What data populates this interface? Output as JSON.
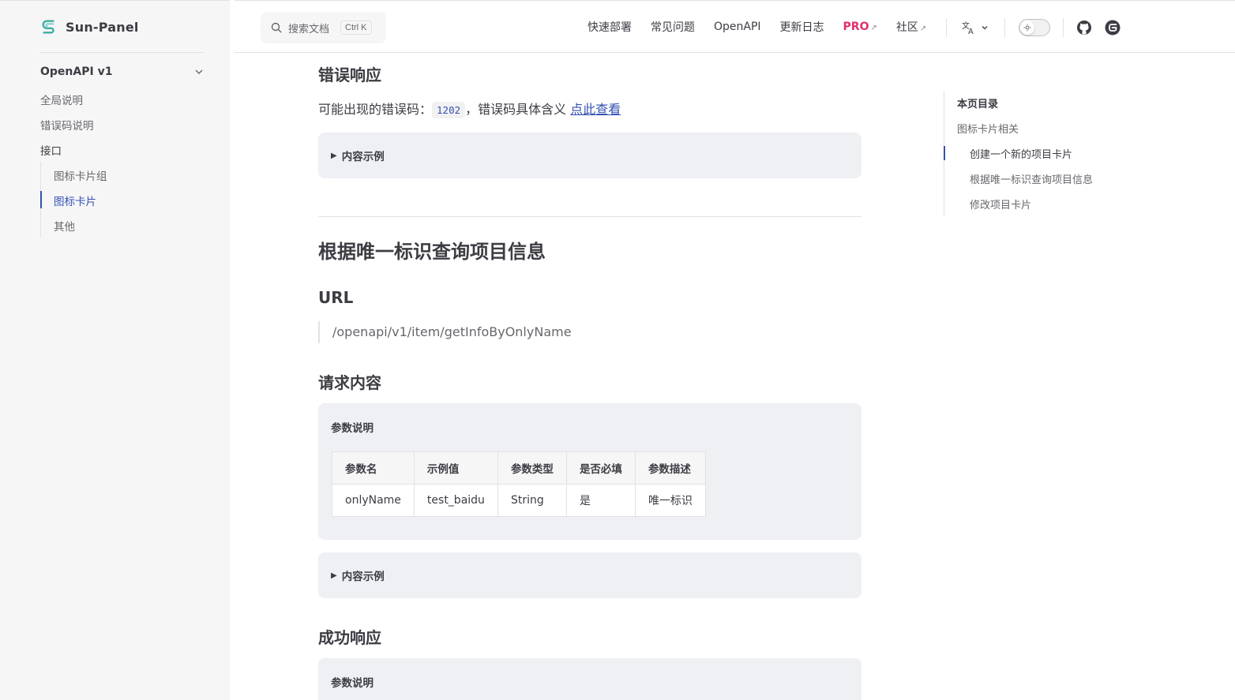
{
  "brand": {
    "name": "Sun-Panel"
  },
  "sidebar": {
    "section_title": "OpenAPI v1",
    "items": [
      {
        "label": "全局说明"
      },
      {
        "label": "错误码说明"
      },
      {
        "label": "接口"
      }
    ],
    "subitems": [
      {
        "label": "图标卡片组"
      },
      {
        "label": "图标卡片",
        "active": true
      },
      {
        "label": "其他"
      }
    ]
  },
  "search": {
    "placeholder": "搜索文档",
    "shortcut": "Ctrl K"
  },
  "topnav": {
    "items": [
      {
        "label": "快速部署"
      },
      {
        "label": "常见问题"
      },
      {
        "label": "OpenAPI"
      },
      {
        "label": "更新日志"
      },
      {
        "label": "PRO",
        "external": "↗"
      },
      {
        "label": "社区",
        "external": "↗"
      }
    ]
  },
  "content": {
    "error_heading": "错误响应",
    "error_text_before": "可能出现的错误码：",
    "error_code": "1202",
    "error_text_after": "，错误码具体含义 ",
    "error_link": "点此查看",
    "details_label_1": "内容示例",
    "section_title": "根据唯一标识查询项目信息",
    "url_heading": "URL",
    "url_value": "/openapi/v1/item/getInfoByOnlyName",
    "request_heading": "请求内容",
    "params_card_title": "参数说明",
    "params_table": {
      "headers": [
        "参数名",
        "示例值",
        "参数类型",
        "是否必填",
        "参数描述"
      ],
      "rows": [
        [
          "onlyName",
          "test_baidu",
          "String",
          "是",
          "唯一标识"
        ]
      ]
    },
    "details_label_2": "内容示例",
    "success_heading": "成功响应",
    "success_card_title": "参数说明"
  },
  "toc": {
    "title": "本页目录",
    "items": [
      {
        "label": "图标卡片相关"
      },
      {
        "label": "创建一个新的项目卡片",
        "active": true
      },
      {
        "label": "根据唯一标识查询项目信息"
      },
      {
        "label": "修改项目卡片"
      }
    ]
  },
  "colors": {
    "brand": "#3451b2",
    "pro": "#e1306c",
    "logo": "#3eaf7c"
  }
}
